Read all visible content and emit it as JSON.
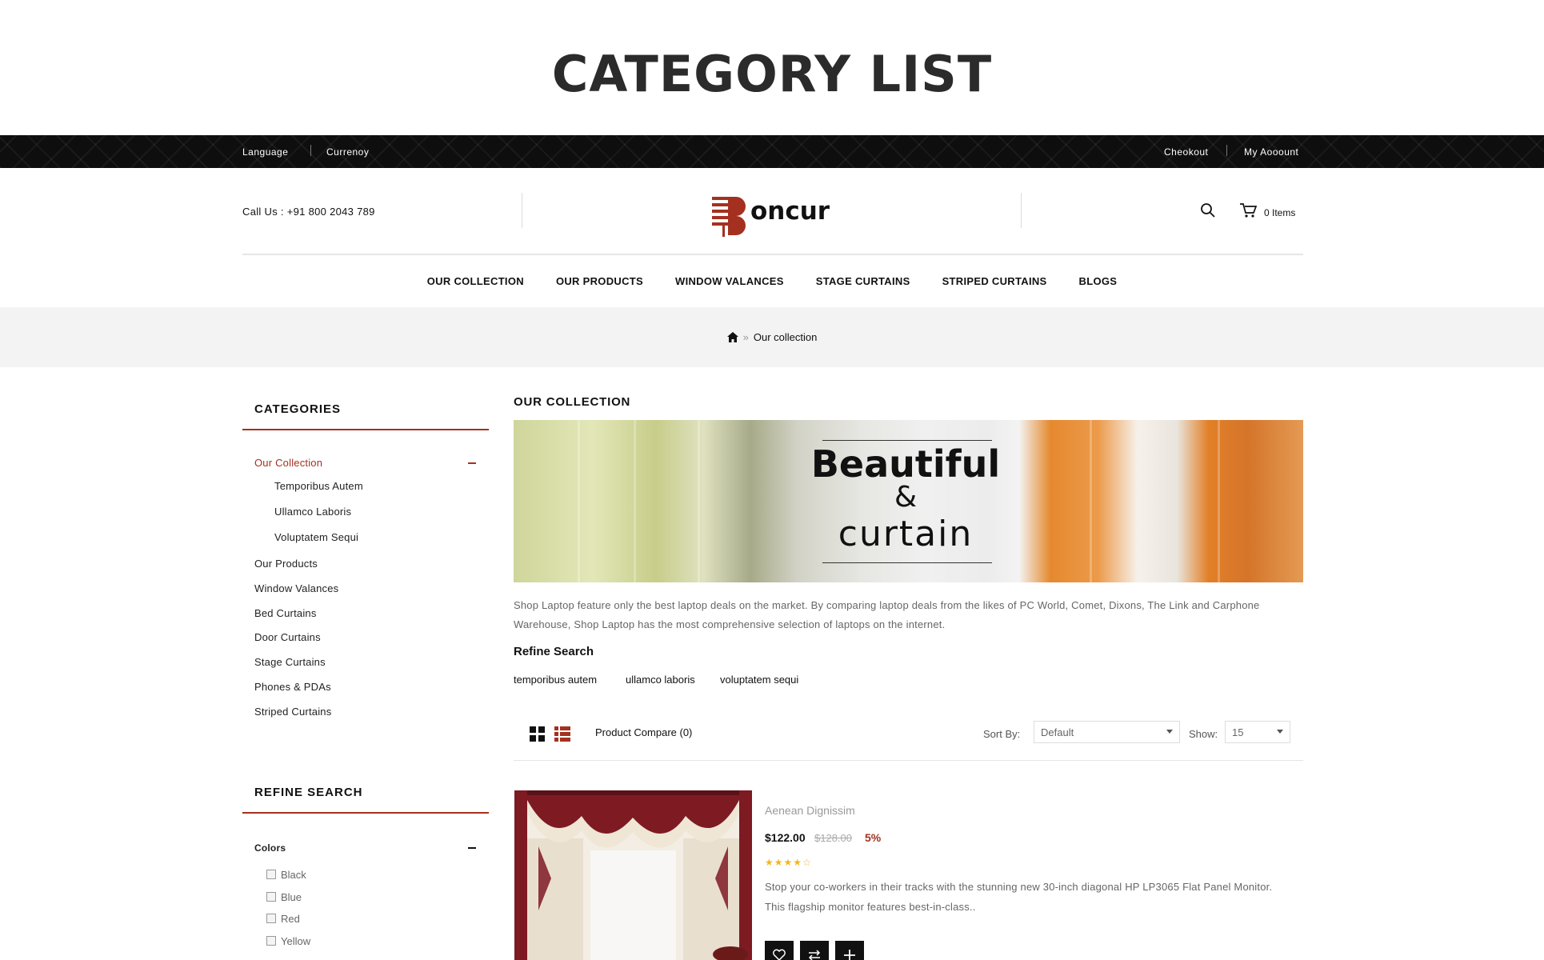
{
  "heading": "CATEGORY LIST",
  "topbar": {
    "language": "Language",
    "currency": "Currenoy",
    "checkout": "Cheokout",
    "account": "My Aooount"
  },
  "header": {
    "call": "Call Us : +91 800 2043 789",
    "logo_text": "oncur",
    "cart_label": "0 Items"
  },
  "nav": [
    "OUR COLLECTION",
    "OUR PRODUCTS",
    "WINDOW VALANCES",
    "STAGE CURTAINS",
    "STRIPED CURTAINS",
    "BLOGS"
  ],
  "breadcrumb": {
    "current": "Our collection"
  },
  "sidebar": {
    "categories_title": "CATEGORIES",
    "categories": [
      {
        "label": "Our Collection",
        "active": true
      },
      {
        "label": "Temporibus Autem",
        "sub": true
      },
      {
        "label": "Ullamco Laboris",
        "sub": true
      },
      {
        "label": "Voluptatem Sequi",
        "sub": true
      },
      {
        "label": "Our Products"
      },
      {
        "label": "Window Valances"
      },
      {
        "label": "Bed Curtains"
      },
      {
        "label": "Door Curtains"
      },
      {
        "label": "Stage Curtains"
      },
      {
        "label": "Phones & PDAs"
      },
      {
        "label": "Striped Curtains"
      }
    ],
    "refine_title": "REFINE SEARCH",
    "colors_label": "Colors",
    "colors": [
      "Black",
      "Blue",
      "Red",
      "Yellow"
    ]
  },
  "main": {
    "title": "OUR COLLECTION",
    "banner": {
      "line1": "Beautiful",
      "line2": "&",
      "line3": "curtain"
    },
    "description": "Shop Laptop feature only the best laptop deals on the market. By comparing laptop deals from the likes of PC World, Comet, Dixons, The Link and Carphone Warehouse, Shop Laptop has the most comprehensive selection of laptops on the internet.",
    "refine_heading": "Refine Search",
    "refine_links": [
      "temporibus autem",
      "ullamco laboris",
      "voluptatem sequi"
    ],
    "toolbar": {
      "compare": "Product Compare (0)",
      "sort_label": "Sort By:",
      "sort_value": "Default",
      "show_label": "Show:",
      "show_value": "15"
    }
  },
  "product": {
    "name": "Aenean Dignissim",
    "price": "$122.00",
    "old_price": "$128.00",
    "discount": "5%",
    "rating": 4,
    "rating_max": 5,
    "description": "Stop your co-workers in their tracks with the stunning new 30-inch diagonal HP LP3065 Flat Panel Monitor. This flagship monitor features best-in-class.."
  },
  "colors": {
    "accent": "#a4311f",
    "topbar": "#0e0e0e",
    "star": "#f3b71d"
  }
}
